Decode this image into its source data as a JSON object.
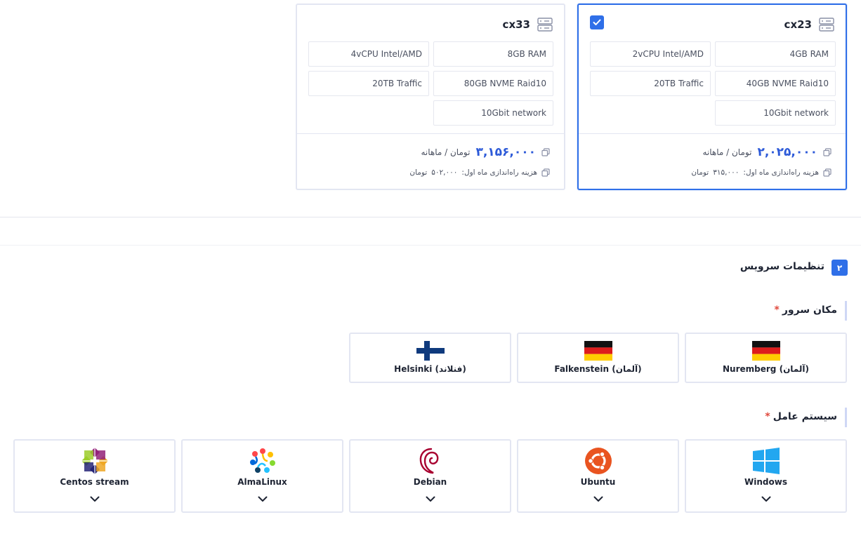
{
  "plans": [
    {
      "name": "cx33",
      "selected": false,
      "specs": [
        "8GB RAM",
        "4vCPU Intel/AMD",
        "80GB NVME Raid10",
        "20TB Traffic",
        "10Gbit network"
      ],
      "price": "۳,۱۵۶,۰۰۰",
      "price_unit": "تومان / ماهانه",
      "setup_label": "هزینه راه‌اندازی ماه اول:",
      "setup_value": "۵۰۲,۰۰۰",
      "setup_unit": "تومان"
    },
    {
      "name": "cx23",
      "selected": true,
      "specs": [
        "4GB RAM",
        "2vCPU Intel/AMD",
        "40GB NVME Raid10",
        "20TB Traffic",
        "10Gbit network"
      ],
      "price": "۲,۰۲۵,۰۰۰",
      "price_unit": "تومان / ماهانه",
      "setup_label": "هزینه راه‌اندازی ماه اول:",
      "setup_value": "۳۱۵,۰۰۰",
      "setup_unit": "تومان"
    }
  ],
  "service_settings": {
    "step_number": "۲",
    "title": "تنظیمات سرویس"
  },
  "location": {
    "label": "مکان سرور",
    "required_mark": "*",
    "options": [
      {
        "label": "Nuremberg (آلمان)",
        "flag": "germany-flag"
      },
      {
        "label": "Falkenstein (آلمان)",
        "flag": "germany-flag"
      },
      {
        "label": "Helsinki (فنلاند)",
        "flag": "finland-flag"
      }
    ]
  },
  "os": {
    "label": "سیستم عامل",
    "required_mark": "*",
    "options": [
      {
        "label": "Windows",
        "icon": "windows-logo-icon"
      },
      {
        "label": "Ubuntu",
        "icon": "ubuntu-logo-icon"
      },
      {
        "label": "Debian",
        "icon": "debian-logo-icon"
      },
      {
        "label": "AlmaLinux",
        "icon": "almalinux-logo-icon"
      },
      {
        "label": "Centos stream",
        "icon": "centos-logo-icon"
      }
    ]
  },
  "colors": {
    "accent": "#2f6fe8",
    "price": "#2d5ad8",
    "required": "#e0483c",
    "border": "#e3e6f2"
  }
}
